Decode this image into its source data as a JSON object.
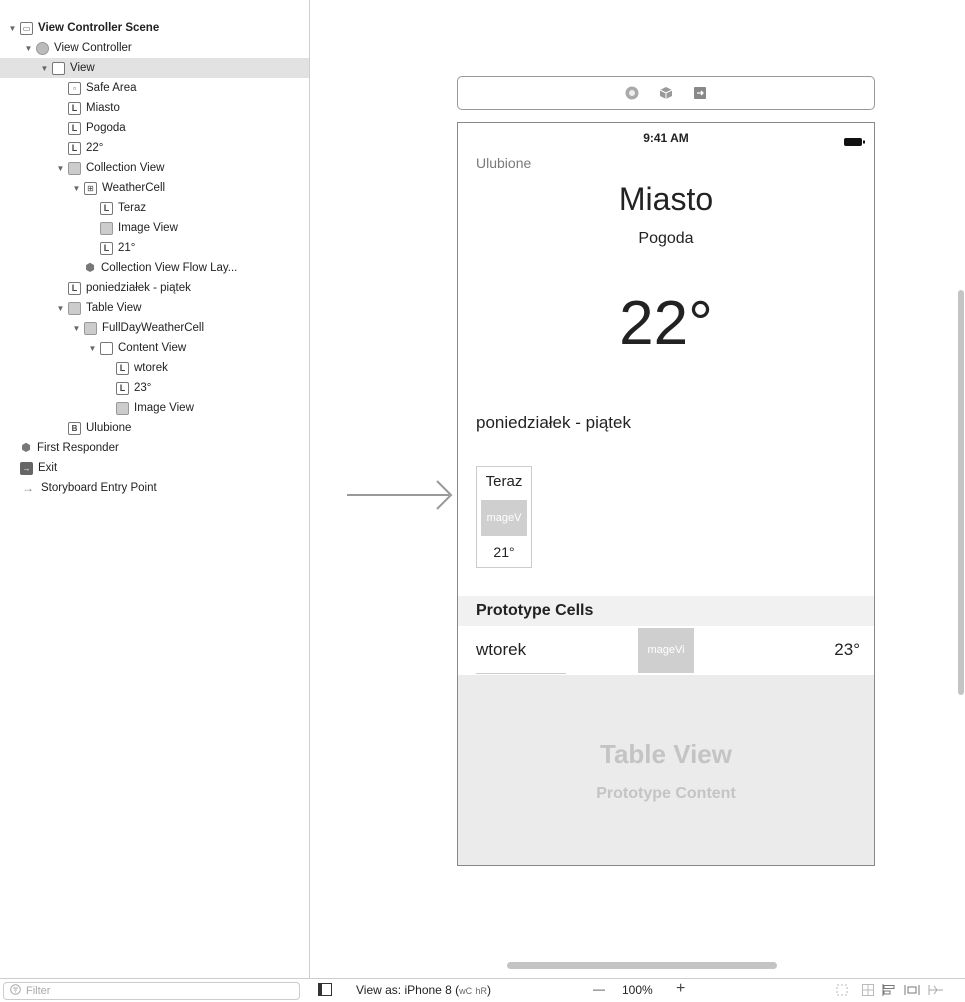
{
  "outline": {
    "items": [
      {
        "label": "View Controller Scene",
        "icon": "scene-icon",
        "indent": 0,
        "expanded": true,
        "bold": true
      },
      {
        "label": "View Controller",
        "icon": "view-controller-icon",
        "indent": 1,
        "expanded": true
      },
      {
        "label": "View",
        "icon": "view-icon",
        "indent": 2,
        "expanded": true,
        "selected": true
      },
      {
        "label": "Safe Area",
        "icon": "safe-area-icon",
        "indent": 3
      },
      {
        "label": "Miasto",
        "icon": "label-icon",
        "indent": 3
      },
      {
        "label": "Pogoda",
        "icon": "label-icon",
        "indent": 3
      },
      {
        "label": "22°",
        "icon": "label-icon",
        "indent": 3
      },
      {
        "label": "Collection View",
        "icon": "collection-view-icon",
        "indent": 3,
        "expanded": true
      },
      {
        "label": "WeatherCell",
        "icon": "collection-cell-icon",
        "indent": 4,
        "expanded": true
      },
      {
        "label": "Teraz",
        "icon": "label-icon",
        "indent": 5
      },
      {
        "label": "Image View",
        "icon": "image-view-icon",
        "indent": 5
      },
      {
        "label": "21°",
        "icon": "label-icon",
        "indent": 5
      },
      {
        "label": "Collection View Flow Lay...",
        "icon": "flow-layout-icon",
        "indent": 4
      },
      {
        "label": "poniedziałek - piątek",
        "icon": "label-icon",
        "indent": 3
      },
      {
        "label": "Table View",
        "icon": "table-view-icon",
        "indent": 3,
        "expanded": true
      },
      {
        "label": "FullDayWeatherCell",
        "icon": "table-cell-icon",
        "indent": 4,
        "expanded": true
      },
      {
        "label": "Content View",
        "icon": "view-icon",
        "indent": 5,
        "expanded": true
      },
      {
        "label": "wtorek",
        "icon": "label-icon",
        "indent": 6
      },
      {
        "label": "23°",
        "icon": "label-icon",
        "indent": 6
      },
      {
        "label": "Image View",
        "icon": "image-view-icon",
        "indent": 6
      },
      {
        "label": "Ulubione",
        "icon": "button-icon",
        "indent": 3
      },
      {
        "label": "First Responder",
        "icon": "first-responder-icon",
        "indent": 0
      },
      {
        "label": "Exit",
        "icon": "exit-icon",
        "indent": 0
      },
      {
        "label": "Storyboard Entry Point",
        "icon": "entry-arrow-icon",
        "indent": 0
      }
    ],
    "filter_placeholder": "Filter"
  },
  "device": {
    "status_time": "9:41 AM",
    "favorites_button": "Ulubione",
    "city_label": "Miasto",
    "weather_label": "Pogoda",
    "temperature_label": "22°",
    "days_label": "poniedziałek - piątek",
    "collection_cell": {
      "time": "Teraz",
      "image_placeholder": "mageV",
      "temp": "21°"
    },
    "prototype_header": "Prototype Cells",
    "table_cell": {
      "day": "wtorek",
      "image_placeholder": "mageVi",
      "temp": "23°"
    },
    "table_placeholder_title": "Table View",
    "table_placeholder_subtitle": "Prototype Content"
  },
  "bottombar": {
    "view_as": "View as: iPhone 8 (",
    "size_class_w": "wC",
    "size_class_h": "hR",
    "size_class_close": ")",
    "zoom_out": "—",
    "zoom_level": "100%",
    "zoom_in": "+"
  }
}
